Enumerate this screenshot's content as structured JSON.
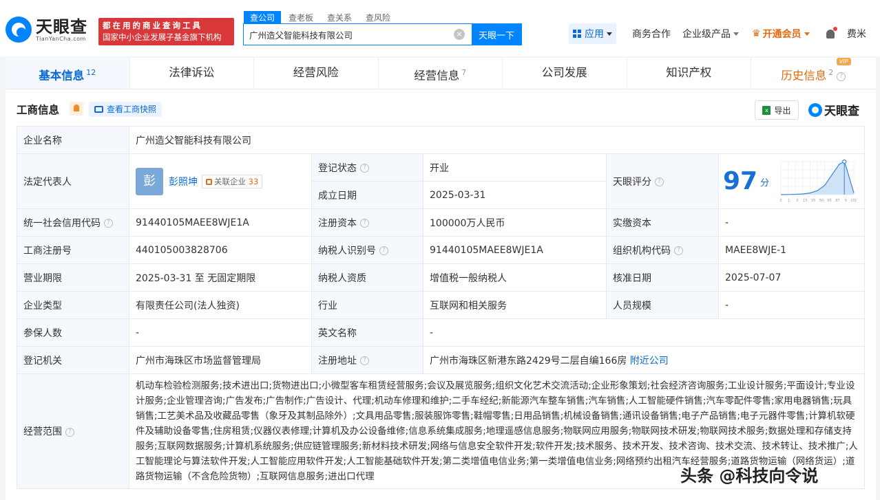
{
  "header": {
    "logo_cn": "天眼查",
    "logo_en": "TianYanCha.com",
    "slogan_line1": "都在用的商业查询工具",
    "slogan_line2": "国家中小企业发展子基金旗下机构",
    "search_tabs": [
      "查公司",
      "查老板",
      "查关系",
      "查风险"
    ],
    "search_value": "广州造父智能科技有限公司",
    "search_button": "天眼一下",
    "nav": {
      "apps": "应用",
      "business": "商务合作",
      "enterprise": "企业级产品",
      "vip": "开通会员",
      "user": "费米"
    }
  },
  "tabs": [
    {
      "label": "基本信息",
      "count": "12"
    },
    {
      "label": "法律诉讼",
      "count": ""
    },
    {
      "label": "经营风险",
      "count": ""
    },
    {
      "label": "经营信息",
      "count": "7"
    },
    {
      "label": "公司发展",
      "count": ""
    },
    {
      "label": "知识产权",
      "count": ""
    },
    {
      "label": "历史信息",
      "count": "2"
    }
  ],
  "tab_vip_badge": "VIP",
  "section": {
    "title": "工商信息",
    "snapshot_btn": "查看工商快照",
    "export_btn": "导出",
    "watermark_logo": "天眼查"
  },
  "info": {
    "company_name_label": "企业名称",
    "company_name": "广州造父智能科技有限公司",
    "legal_rep_label": "法定代表人",
    "legal_rep_avatar": "彭",
    "legal_rep_name": "彭照坤",
    "related_label": "关联企业",
    "related_count": "33",
    "reg_status_label": "登记状态",
    "reg_status": "开业",
    "found_date_label": "成立日期",
    "found_date": "2025-03-31",
    "score_label": "天眼评分",
    "score": "97",
    "score_unit": "分",
    "credit_code_label": "统一社会信用代码",
    "credit_code": "91440105MAEE8WJE1A",
    "reg_capital_label": "注册资本",
    "reg_capital": "100000万人民币",
    "paid_capital_label": "实缴资本",
    "paid_capital": "-",
    "reg_no_label": "工商注册号",
    "reg_no": "440105003828706",
    "taxpayer_id_label": "纳税人识别号",
    "taxpayer_id": "91440105MAEE8WJE1A",
    "org_code_label": "组织机构代码",
    "org_code": "MAEE8WJE-1",
    "term_label": "营业期限",
    "term": "2025-03-31 至 无固定期限",
    "taxpayer_qual_label": "纳税人资质",
    "taxpayer_qual": "增值税一般纳税人",
    "approve_date_label": "核准日期",
    "approve_date": "2025-07-07",
    "type_label": "企业类型",
    "type": "有限责任公司(法人独资)",
    "industry_label": "行业",
    "industry": "互联网和相关服务",
    "staff_label": "人员规模",
    "staff": "-",
    "insured_label": "参保人数",
    "insured": "-",
    "en_name_label": "英文名称",
    "en_name": "-",
    "authority_label": "登记机关",
    "authority": "广州市海珠区市场监督管理局",
    "address_label": "注册地址",
    "address": "广州市海珠区新港东路2429号二层自编166房",
    "nearby_link": "附近公司",
    "scope_label": "经营范围",
    "scope": "机动车检验检测服务;技术进出口;货物进出口;小微型客车租赁经营服务;会议及展览服务;组织文化艺术交流活动;企业形象策划;社会经济咨询服务;工业设计服务;平面设计;专业设计服务;企业管理咨询;广告发布;广告制作;广告设计、代理;机动车修理和维护;二手车经纪;新能源汽车整车销售;汽车销售;人工智能硬件销售;汽车零配件零售;家用电器销售;玩具销售;工艺美术品及收藏品零售（象牙及其制品除外）;文具用品零售;服装服饰零售;鞋帽零售;日用品销售;机械设备销售;通讯设备销售;电子产品销售;电子元器件零售;计算机软硬件及辅助设备零售;住房租赁;仪器仪表修理;计算机及办公设备维修;信息系统集成服务;地理遥感信息服务;物联网应用服务;物联网技术研发;物联网技术服务;数据处理和存储支持服务;互联网数据服务;计算机系统服务;供应链管理服务;新材料技术研发;网络与信息安全软件开发;软件开发;技术服务、技术开发、技术咨询、技术交流、技术转让、技术推广;人工智能理论与算法软件开发;人工智能应用软件开发;人工智能基础软件开发;第二类增值电信业务;第一类增值电信业务;网络预约出租汽车经营服务;道路货物运输（网络货运）;道路货物运输（不含危险货物）;互联网信息服务;进出口代理"
  },
  "chart_data": {
    "type": "area",
    "x": [
      0,
      10,
      20,
      30,
      40,
      50,
      60,
      70,
      80,
      87,
      90,
      100
    ],
    "values": [
      0,
      0.5,
      1,
      2,
      5,
      12,
      28,
      60,
      92,
      100,
      80,
      5
    ],
    "xticks": [
      "0",
      "1",
      "3",
      "15",
      "35",
      "50",
      "65",
      "87",
      "9",
      "100"
    ],
    "marker_x": 87,
    "ylim": [
      0,
      100
    ]
  },
  "footer_watermark": "头条 @科技向令说",
  "colors": {
    "brand": "#0084ff",
    "accent": "#0b6bd6",
    "vip": "#e26b10",
    "open": "#1aa34a",
    "slogan_bg": "#d9383a"
  }
}
